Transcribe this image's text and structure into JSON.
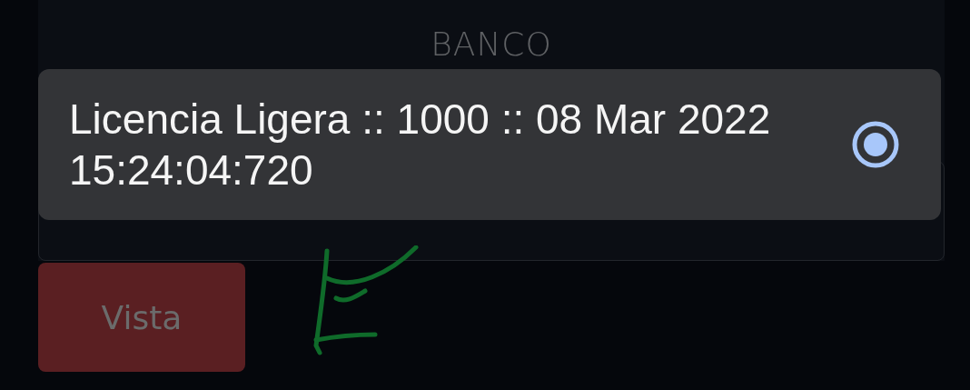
{
  "form": {
    "label": "BANCO"
  },
  "dropdown": {
    "options": [
      {
        "label": "Licencia Ligera :: 1000 :: 08 Mar 2022 15:24:04:720",
        "selected": true
      }
    ]
  },
  "buttons": [
    {
      "label": "Vista",
      "disabled": true
    }
  ]
}
